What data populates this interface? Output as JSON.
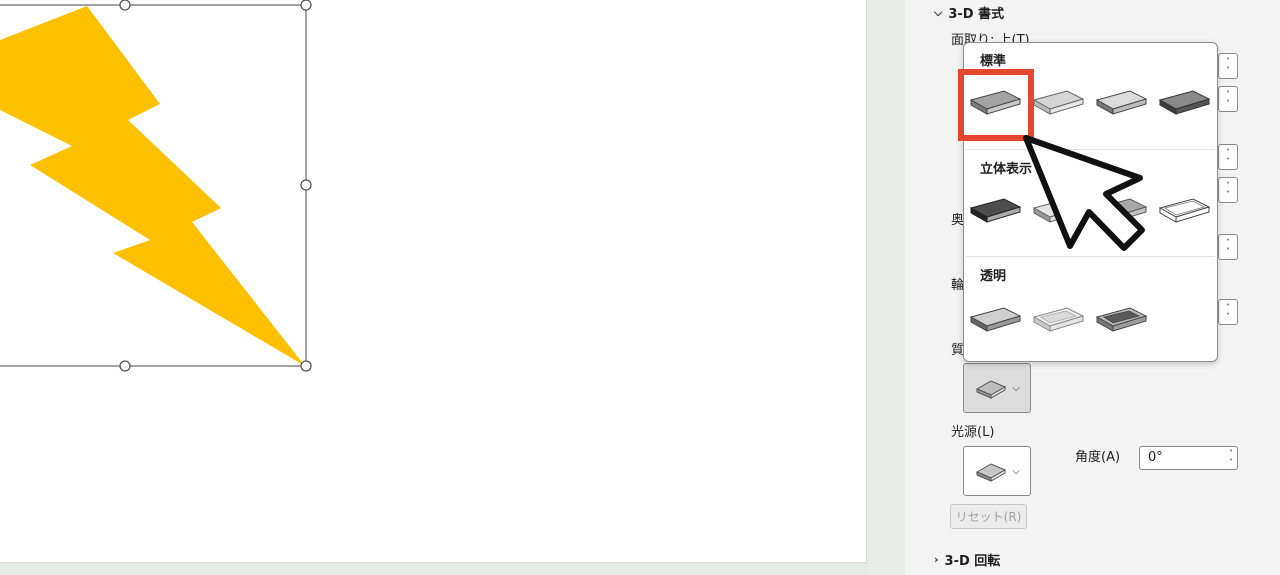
{
  "pane": {
    "section_3d_format": "3-D 書式",
    "bevel_top_label": "面取り: 上(T)",
    "label_depth_partial": "奥",
    "label_contour_partial": "輪",
    "label_material_partial": "質",
    "light_source_label": "光源(L)",
    "angle_label": "角度(A)",
    "angle_value": "0°",
    "reset_label": "リセット(R)",
    "section_3d_rotation": "3-D 回転"
  },
  "gallery": {
    "groups": [
      {
        "title": "標準",
        "items": [
          "matte",
          "warm-matte",
          "plastic",
          "metal"
        ]
      },
      {
        "title": "立体表示",
        "items": [
          "dark-edge",
          "soft-edge",
          "flat",
          "wireframe"
        ]
      },
      {
        "title": "透明",
        "items": [
          "powder",
          "clear",
          "translucent-powder"
        ]
      }
    ]
  },
  "colors": {
    "lightning": "#FFC000",
    "highlight": "#E5482E"
  },
  "icons": [
    "chevron-down-icon",
    "chevron-right-icon",
    "material-preview-icon",
    "cursor-arrow-icon",
    "spin-up-icon",
    "spin-down-icon"
  ]
}
